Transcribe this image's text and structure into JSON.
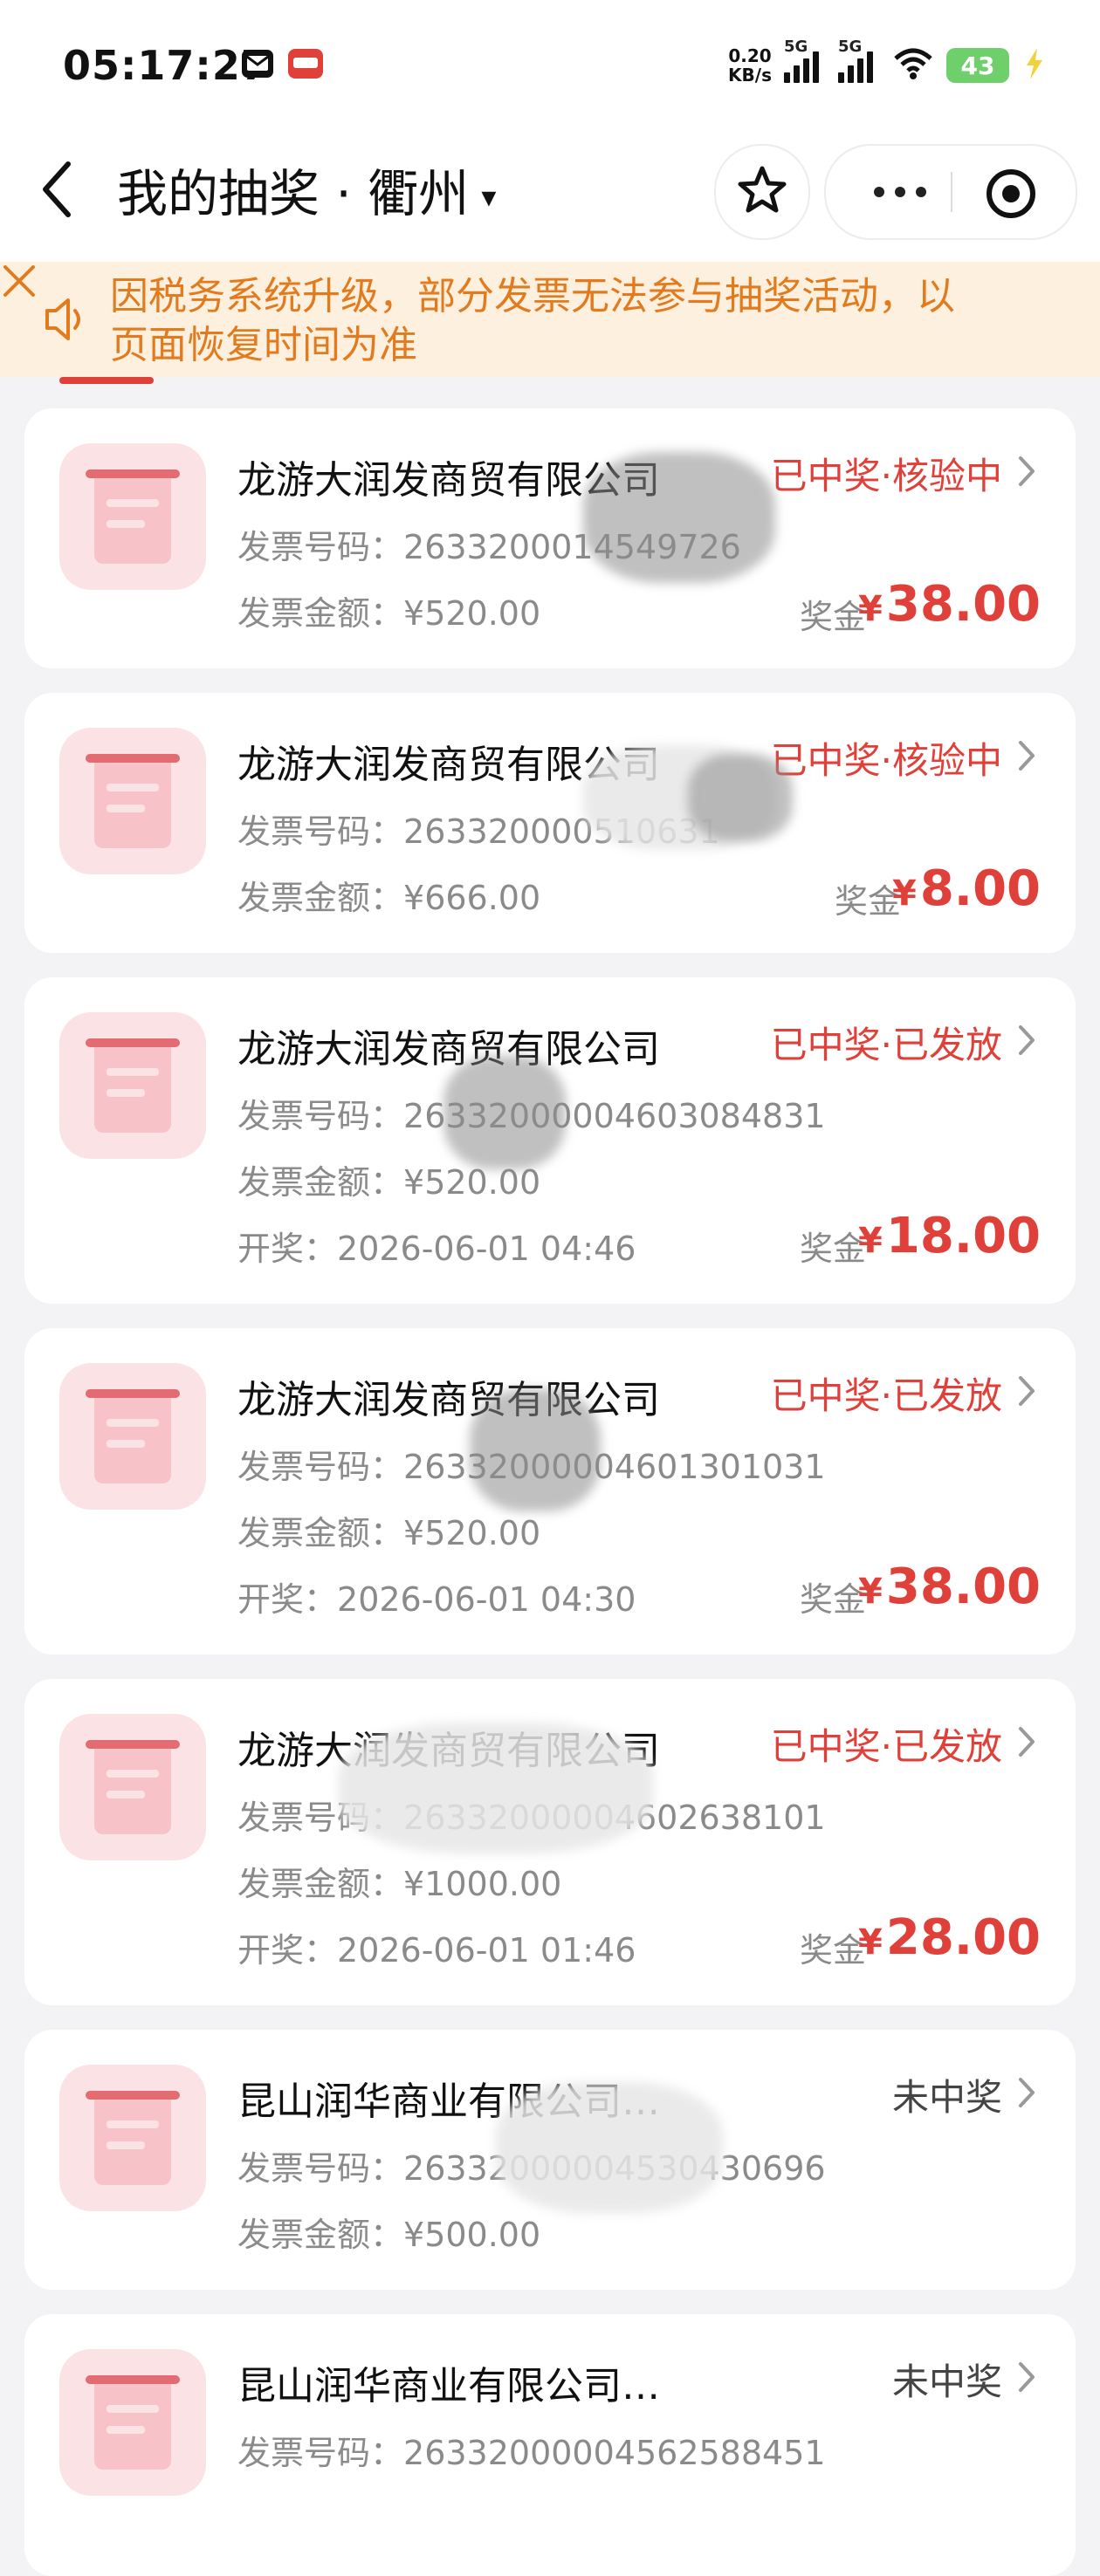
{
  "status_bar": {
    "time": "05:17:27",
    "net_speed_value": "0.20",
    "net_speed_unit": "KB/s",
    "sim1": "5G",
    "sim2": "5G",
    "battery": "43"
  },
  "nav": {
    "title": "我的抽奖 · 衢州",
    "caret": "▾"
  },
  "notice": {
    "text": "因税务系统升级，部分发票无法参与抽奖活动，以页面恢复时间为准"
  },
  "labels": {
    "invoice_no": "发票号码：",
    "invoice_amount": "发票金额：",
    "draw_time": "开奖：",
    "prize": "奖金",
    "currency": "¥"
  },
  "cards": [
    {
      "company": "龙游大润发商贸有限公司",
      "status": "已中奖·核验中",
      "invoice_no": "2633200014549726",
      "amount": "¥520.00",
      "draw_time": "",
      "prize": "38.00"
    },
    {
      "company": "龙游大润发商贸有限公司",
      "status": "已中奖·核验中",
      "invoice_no": "263320000510631",
      "amount": "¥666.00",
      "draw_time": "",
      "prize": "8.00"
    },
    {
      "company": "龙游大润发商贸有限公司",
      "status": "已中奖·已发放",
      "invoice_no": "26332000004603084831",
      "amount": "¥520.00",
      "draw_time": "2026-06-01 04:46",
      "prize": "18.00"
    },
    {
      "company": "龙游大润发商贸有限公司",
      "status": "已中奖·已发放",
      "invoice_no": "26332000004601301031",
      "amount": "¥520.00",
      "draw_time": "2026-06-01 04:30",
      "prize": "38.00"
    },
    {
      "company": "龙游大润发商贸有限公司",
      "status": "已中奖·已发放",
      "invoice_no": "26332000004602638101",
      "amount": "¥1000.00",
      "draw_time": "2026-06-01 01:46",
      "prize": "28.00"
    },
    {
      "company": "昆山润华商业有限公司…",
      "status": "未中奖",
      "invoice_no": "26332000004530430696",
      "amount": "¥500.00",
      "draw_time": "",
      "prize": ""
    },
    {
      "company": "昆山润华商业有限公司…",
      "status": "未中奖",
      "invoice_no": "26332000004562588451",
      "amount": "",
      "draw_time": "",
      "prize": ""
    }
  ],
  "colors": {
    "accent": "#e0403a",
    "notice_text": "#e27a1e",
    "notice_bg": "#fdf0de",
    "page_bg": "#f3f3f6"
  }
}
